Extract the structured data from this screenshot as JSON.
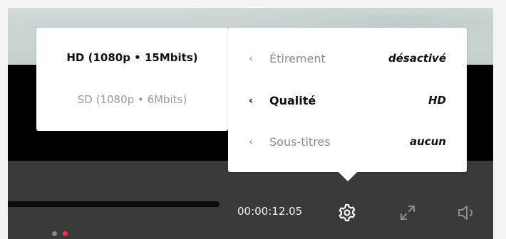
{
  "quality_menu": {
    "options": [
      "HD (1080p  •  15Mbits)",
      "SD (1080p  •  6Mbits)"
    ],
    "selected_index": 0
  },
  "settings_menu": {
    "rows": [
      {
        "label": "Étirement",
        "value": "désactivé"
      },
      {
        "label": "Qualité",
        "value": "HD"
      },
      {
        "label": "Sous-titres",
        "value": "aucun"
      }
    ],
    "active_index": 1,
    "chevron": "‹"
  },
  "player": {
    "time": "00:00:12.05",
    "icons": [
      "gear-icon",
      "fullscreen-icon",
      "volume-icon"
    ],
    "pagination_dots": 2,
    "active_dot": 1,
    "colors": {
      "dot_inactive": "#8a8a8a",
      "dot_active": "#e8334a"
    }
  }
}
